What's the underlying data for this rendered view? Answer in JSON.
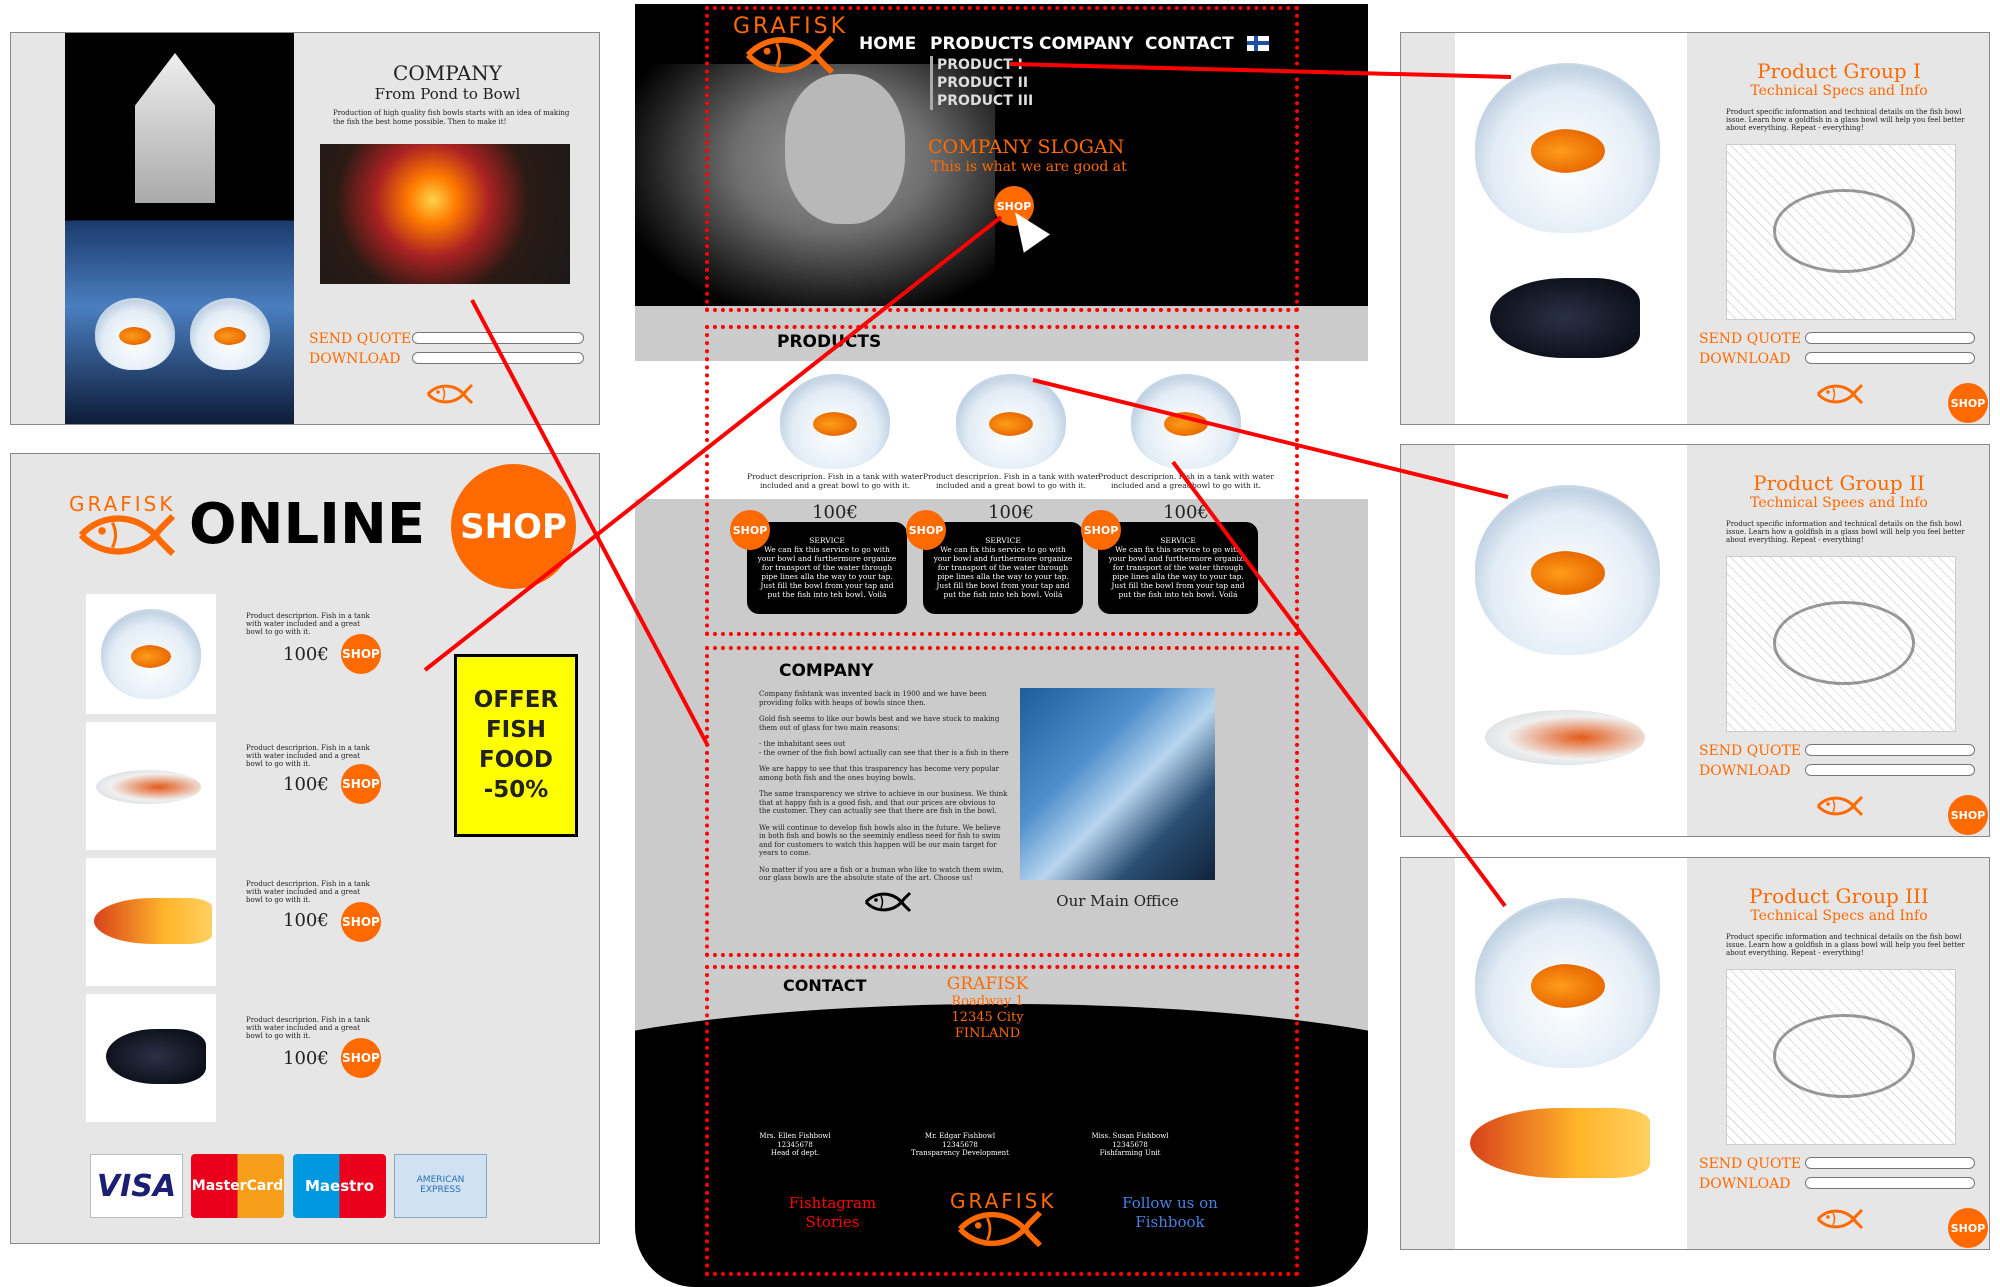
{
  "brand": {
    "logo": "GRAFISK",
    "accent": "#ff6a00",
    "connector_color": "#ff0000"
  },
  "company_page": {
    "title": "COMPANY",
    "subtitle": "From Pond to Bowl",
    "intro": "Production of high quality fish bowls starts with an idea of making the fish the best home possible. Then to make it!",
    "send_quote": "SEND QUOTE",
    "download": "DOWNLOAD"
  },
  "shop_page": {
    "logo": "GRAFISK",
    "online": "ONLINE",
    "shop": "SHOP",
    "items": [
      {
        "desc": "Product descriprion. Fish in a tank with water included and a great bowl to go with it.",
        "price": "100€",
        "shop": "SHOP"
      },
      {
        "desc": "Product descriprion. Fish in a tank with water included and a great bowl to go with it.",
        "price": "100€",
        "shop": "SHOP"
      },
      {
        "desc": "Product descriprion. Fish in a tank with water included and a great bowl to go with it.",
        "price": "100€",
        "shop": "SHOP"
      },
      {
        "desc": "Product descriprion. Fish in a tank with water included and a great bowl to go with it.",
        "price": "100€",
        "shop": "SHOP"
      }
    ],
    "offer": [
      "OFFER",
      "FISH",
      "FOOD",
      "-50%"
    ],
    "payments": [
      "VISA",
      "MasterCard",
      "Maestro",
      "AMERICAN EXPRESS"
    ]
  },
  "main": {
    "nav": [
      "HOME",
      "PRODUCTS",
      "COMPANY",
      "CONTACT"
    ],
    "submenu": [
      "PRODUCT I",
      "PRODUCT II",
      "PRODUCT III"
    ],
    "slogan": "COMPANY SLOGAN",
    "tagline": "This is what we are good at",
    "hero_shop": "SHOP",
    "products_title": "PRODUCTS",
    "products": [
      {
        "desc": "Product descriprion. Fish in a tank with water included and a great bowl to go with it.",
        "price": "100€",
        "shop": "SHOP",
        "service_title": "SERVICE",
        "service": "We can fix this service to go with your bowl and furthermore organize for transport of the water through pipe lines alla the way to your tap. Just fill the bowl from your tap and put the fish into teh bowl. Voilá"
      },
      {
        "desc": "Product descriprion. Fish in a tank with water included and a great bowl to go with it.",
        "price": "100€",
        "shop": "SHOP",
        "service_title": "SERVICE",
        "service": "We can fix this service to go with your bowl and furthermore organize for transport of the water through pipe lines alla the way to your tap. Just fill the bowl from your tap and put the fish into teh bowl. Voilá"
      },
      {
        "desc": "Product descriprion. Fish in a tank with water included and a great bowl to go with it.",
        "price": "100€",
        "shop": "SHOP",
        "service_title": "SERVICE",
        "service": "We can fix this service to go with your bowl and furthermore organize for transport of the water through pipe lines alla the way to your tap. Just fill the bowl from your tap and put the fish into teh bowl. Voilá"
      }
    ],
    "company_title": "COMPANY",
    "company_paragraphs": [
      "Company fishtank was invented back in 1900 and we have been providing folks with heaps of bowls since then.",
      "Gold fish seems to like our bowls best and we have stuck to making them out of glass for two main reasons:",
      "- the inhabitant sees out\n- the owner of the fish bowl actually can see that ther is a fish in there",
      "We are happy to see that this trasparency has become very popular among both fish and the ones buying bowls.",
      "The same transparency we strive to achieve in our business. We think that at happy fish is a good fish, and that our prices are obvious to the customer. They can actually see that there are fish in the bowl.",
      "We will continue to develop fish bowls also in the future. We believe in both fish and bowls so the seeminly endless need for fish to swim and for customers to watch this happen will be our main target for years to come.",
      "No matter if you are a fish or a human who like to watch them swim, our glass bowls are the absolute state of the art. Choose us!"
    ],
    "office_caption": "Our Main Office",
    "contact_title": "CONTACT",
    "address": [
      "GRAFISK",
      "Roadway 1",
      "12345 City",
      "FINLAND"
    ],
    "people": [
      {
        "name": "Mrs. Ellen Fishbowl",
        "phone": "12345678",
        "role": "Head of dept."
      },
      {
        "name": "Mr. Edgar Fishbowl",
        "phone": "12345678",
        "role": "Transparency Development"
      },
      {
        "name": "Miss. Susan Fishbowl",
        "phone": "12345678",
        "role": "Fishfarming Unit"
      }
    ],
    "fishtagram": "Fishtagram Stories",
    "fishbook": "Follow us on Fishbook",
    "footer_logo": "GRAFISK"
  },
  "product_pages": [
    {
      "title": "Product Group I",
      "subtitle": "Technical Specs and Info",
      "text": "Product specific information and technical details on the fish bowl issue. Learn how a goldfish in a glass bowl will help you feel better about everything. Repeat - everything!",
      "send_quote": "SEND QUOTE",
      "download": "DOWNLOAD",
      "shop": "SHOP"
    },
    {
      "title": "Product Group II",
      "subtitle": "Technical Spees and Info",
      "text": "Product specific information and technical details on the fish bowl issue. Learn how a goldfish in a glass bowl will help you feel better about everything. Repeat - everything!",
      "send_quote": "SEND QUOTE",
      "download": "DOWNLOAD",
      "shop": "SHOP"
    },
    {
      "title": "Product Group III",
      "subtitle": "Technical Specs and Info",
      "text": "Product specific information and technical details on the fish bowl issue. Learn how a goldfish in a glass bowl will help you feel better about everything. Repeat - everything!",
      "send_quote": "SEND QUOTE",
      "download": "DOWNLOAD",
      "shop": "SHOP"
    }
  ]
}
